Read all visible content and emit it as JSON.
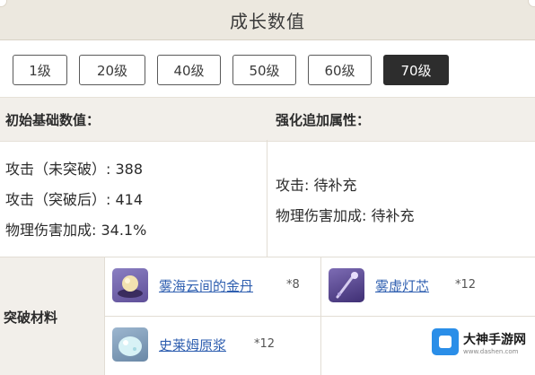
{
  "header": {
    "title": "成长数值"
  },
  "levels": [
    {
      "label": "1级",
      "active": false
    },
    {
      "label": "20级",
      "active": false
    },
    {
      "label": "40级",
      "active": false
    },
    {
      "label": "50级",
      "active": false
    },
    {
      "label": "60级",
      "active": false
    },
    {
      "label": "70级",
      "active": true
    }
  ],
  "base_stats": {
    "heading": "初始基础数值：",
    "lines": [
      "攻击（未突破）: 388",
      "攻击（突破后）: 414",
      "物理伤害加成: 34.1%"
    ]
  },
  "refine_stats": {
    "heading": "强化追加属性：",
    "lines": [
      "攻击: 待补充",
      "物理伤害加成: 待补充"
    ]
  },
  "materials": {
    "label": "突破材料",
    "items": [
      {
        "name": "雾海云间的金丹",
        "count": "*8",
        "icon": "golden-pill-icon"
      },
      {
        "name": "雾虚灯芯",
        "count": "*12",
        "icon": "lamp-wick-icon"
      },
      {
        "name": "史莱姆原浆",
        "count": "*12",
        "icon": "slime-concentrate-icon"
      }
    ]
  },
  "watermark": {
    "title": "大神手游网",
    "subtitle": "www.dashen.com"
  },
  "colors": {
    "header_bg": "#ece8df",
    "active_level": "#2d2d2d",
    "link": "#2f5fb0",
    "brand": "#2a8ee8"
  }
}
